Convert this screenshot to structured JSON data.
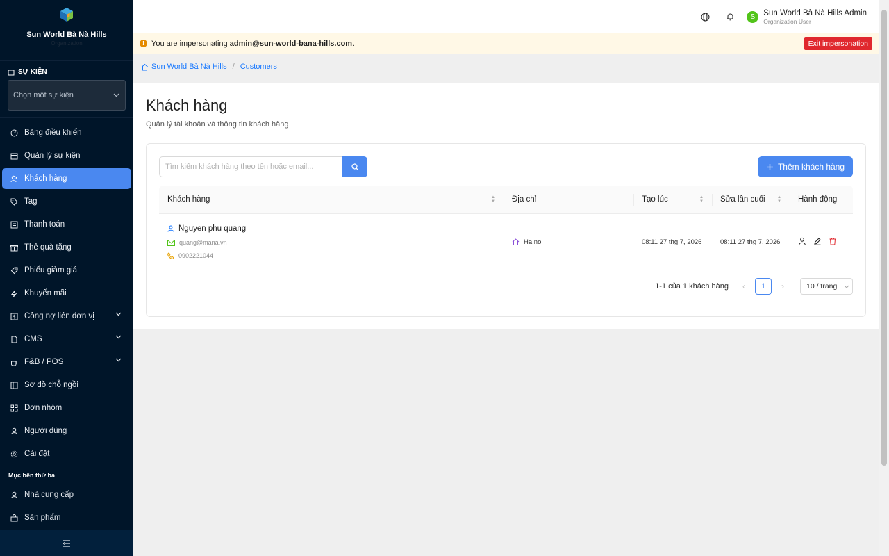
{
  "sidebar": {
    "brand_name": "Sun World Bà Nà Hills",
    "brand_sub": "Organization",
    "event_section_title": "SỰ KIỆN",
    "event_select_placeholder": "Chọn một sự kiện",
    "items": [
      {
        "label": "Bảng điều khiển",
        "icon": "dashboard-icon"
      },
      {
        "label": "Quản lý sự kiện",
        "icon": "calendar-icon"
      },
      {
        "label": "Khách hàng",
        "icon": "customers-icon"
      },
      {
        "label": "Tag",
        "icon": "tag-icon"
      },
      {
        "label": "Thanh toán",
        "icon": "payment-icon"
      },
      {
        "label": "Thẻ quà tặng",
        "icon": "gift-icon"
      },
      {
        "label": "Phiếu giảm giá",
        "icon": "coupon-icon"
      },
      {
        "label": "Khuyến mãi",
        "icon": "promotion-icon"
      },
      {
        "label": "Công nợ liên đơn vị",
        "icon": "debt-icon"
      },
      {
        "label": "CMS",
        "icon": "cms-icon"
      },
      {
        "label": "F&B / POS",
        "icon": "coffee-icon"
      },
      {
        "label": "Sơ đồ chỗ ngồi",
        "icon": "seat-map-icon"
      },
      {
        "label": "Đơn nhóm",
        "icon": "group-order-icon"
      },
      {
        "label": "Người dùng",
        "icon": "user-icon"
      },
      {
        "label": "Cài đặt",
        "icon": "settings-icon"
      }
    ],
    "third_party_section": "Mục bên thứ ba",
    "third_party_items": [
      {
        "label": "Nhà cung cấp",
        "icon": "supplier-icon"
      },
      {
        "label": "Sản phẩm",
        "icon": "product-icon"
      }
    ]
  },
  "header": {
    "user_name": "Sun World Bà Nà Hills Admin",
    "user_role": "Organization User",
    "avatar_letter": "S"
  },
  "impersonation": {
    "prefix": "You are impersonating ",
    "email": "admin@sun-world-bana-hills.com",
    "suffix": ".",
    "exit_label": "Exit impersonation"
  },
  "breadcrumb": {
    "home": "Sun World Bà Nà Hills",
    "separator": "/",
    "current": "Customers"
  },
  "page": {
    "title": "Khách hàng",
    "subtitle": "Quản lý tài khoản và thông tin khách hàng"
  },
  "search": {
    "placeholder": "Tìm kiếm khách hàng theo tên hoặc email..."
  },
  "add_button_label": "Thêm khách hàng",
  "table": {
    "columns": [
      "Khách hàng",
      "Địa chỉ",
      "Tạo lúc",
      "Sửa lần cuối",
      "Hành động"
    ],
    "rows": [
      {
        "name": "Nguyen phu quang",
        "email": "quang@mana.vn",
        "phone": "0902221044",
        "address": "Ha noi",
        "created": "08:11 27 thg 7, 2026",
        "updated": "08:11 27 thg 7, 2026"
      }
    ]
  },
  "pagination": {
    "summary": "1-1 của 1 khách hàng",
    "current_page": "1",
    "page_size": "10 / trang"
  },
  "colors": {
    "sidebar_bg": "#001529",
    "primary": "#4a88f0",
    "danger": "#e0282e",
    "warning": "#e48a00",
    "avatar": "#52c41a"
  }
}
